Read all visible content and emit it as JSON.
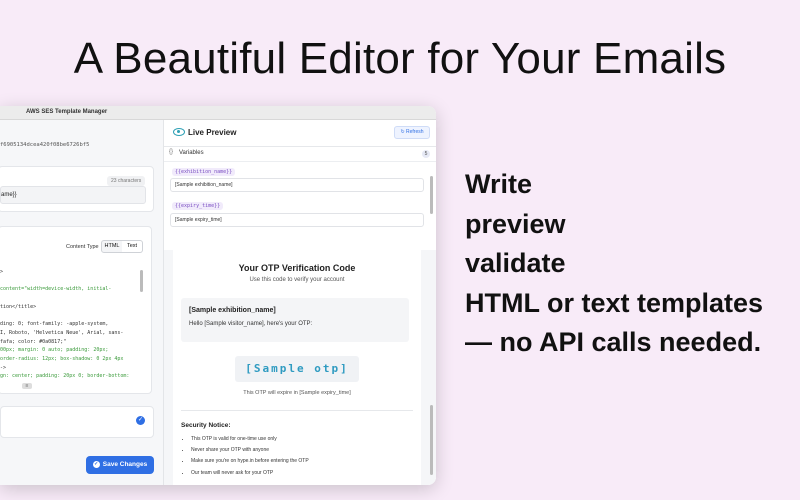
{
  "headline": "A Beautiful Editor for Your Emails",
  "bullets": [
    "Write",
    "preview",
    "validate",
    "HTML or text templates",
    "— no API calls needed."
  ],
  "window": {
    "title": "AWS SES Template Manager",
    "template_id": "f6905134dcea420f08be6726bf5",
    "subject_counter": "23 characters",
    "subject_value": "ame}}",
    "content_type_label": "Content Type",
    "content_types": [
      "HTML",
      "Text"
    ],
    "code_lines": [
      {
        "t": ">",
        "g": false
      },
      {
        "t": "",
        "g": false
      },
      {
        "t": "content=\"width=device-width, initial-",
        "g": true
      },
      {
        "t": "",
        "g": false
      },
      {
        "t": "tion</title>",
        "g": false
      },
      {
        "t": "",
        "g": false
      },
      {
        "t": "ding: 0; font-family: -apple-system,",
        "g": false
      },
      {
        "t": "I, Roboto, 'Helvetica Neue', Arial, sans-",
        "g": false
      },
      {
        "t": "fafa; color: #0a0817;\"",
        "g": false
      },
      {
        "t": "00px; margin: 0 auto; padding: 20px;",
        "g": true
      },
      {
        "t": "order-radius: 12px; box-shadow: 0 2px 4px",
        "g": true
      },
      {
        "t": "->",
        "g": false
      },
      {
        "t": "gn: center; padding: 20px 0; border-bottom:",
        "g": true
      },
      {
        "t": "",
        "g": false
      },
      {
        "t": "ings_url}}\" alt=\"Exhibition Logo\"",
        "g": true
      },
      {
        "t": "0%; auto;\"",
        "g": true
      }
    ],
    "save_label": "Save Changes",
    "preview": {
      "title": "Live Preview",
      "refresh_label": "Refresh",
      "variables_label": "Variables",
      "variables_count": "5",
      "variables": [
        {
          "tag": "{{exhibition_name}}",
          "value": "[Sample exhibition_name]"
        },
        {
          "tag": "{{expiry_time}}",
          "value": "[Sample expiry_time]"
        }
      ],
      "email": {
        "title": "Your OTP Verification Code",
        "subtitle": "Use this code to verify your account",
        "box_heading": "[Sample exhibition_name]",
        "box_text": "Hello [Sample visitor_name], here's your OTP:",
        "otp": "[Sample otp]",
        "expiry": "This OTP will expire in [Sample expiry_time]",
        "security_heading": "Security Notice:",
        "security_items": [
          "This OTP is valid for one-time use only",
          "Never share your OTP with anyone",
          "Make sure you're on hype.in before entering the OTP",
          "Our team will never ask for your OTP"
        ]
      }
    }
  }
}
